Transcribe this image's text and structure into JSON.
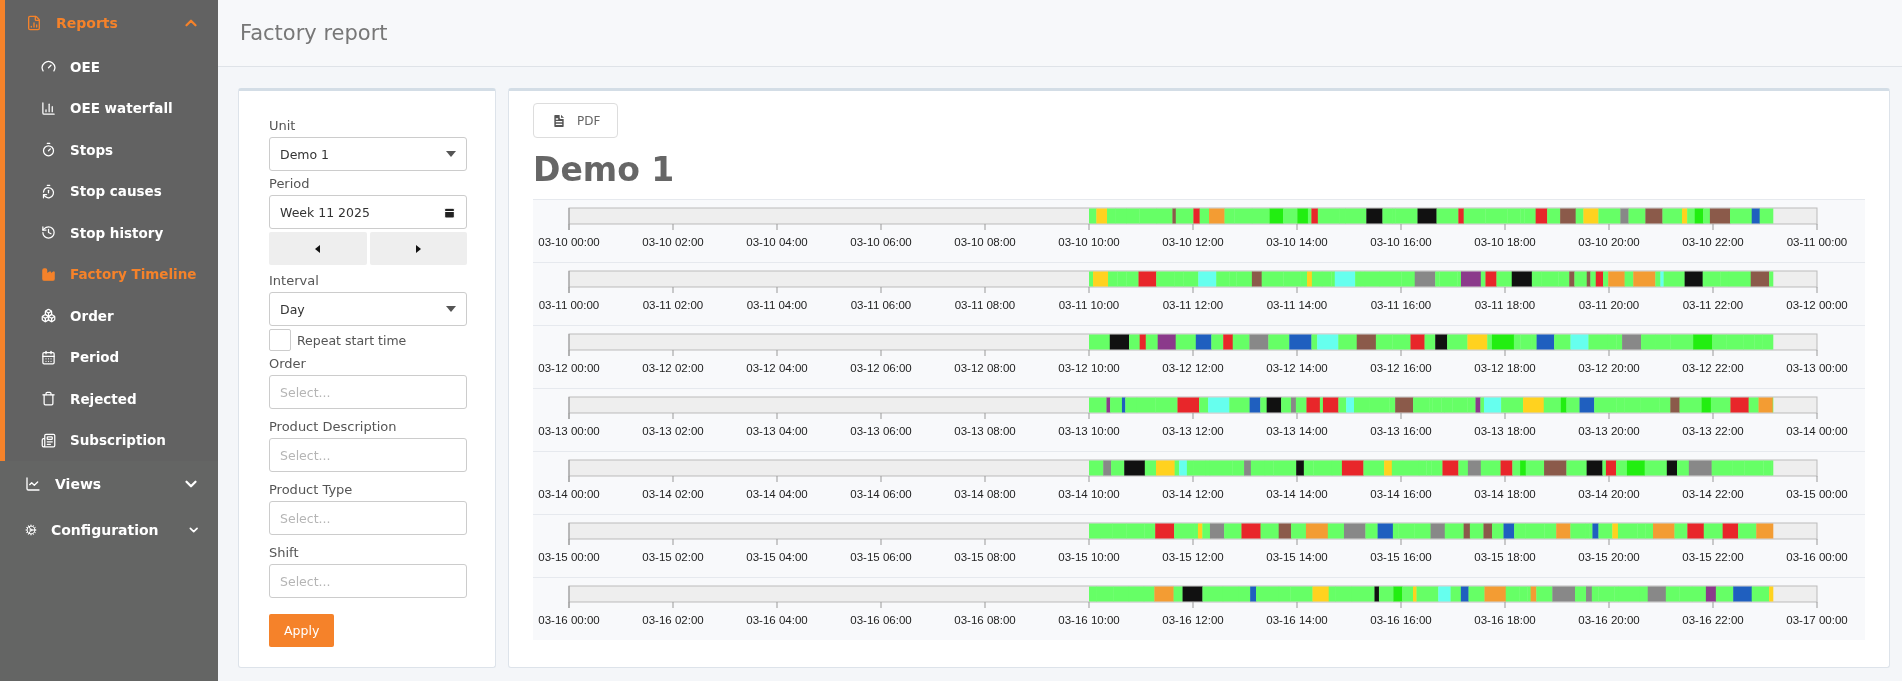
{
  "sidebar": {
    "items": [
      {
        "label": "Reports",
        "expanded": true,
        "children": [
          {
            "label": "OEE",
            "selected": false
          },
          {
            "label": "OEE waterfall",
            "selected": false
          },
          {
            "label": "Stops",
            "selected": false
          },
          {
            "label": "Stop causes",
            "selected": false
          },
          {
            "label": "Stop history",
            "selected": false
          },
          {
            "label": "Factory Timeline",
            "selected": true
          },
          {
            "label": "Order",
            "selected": false
          },
          {
            "label": "Period",
            "selected": false
          },
          {
            "label": "Rejected",
            "selected": false
          },
          {
            "label": "Subscription",
            "selected": false
          }
        ]
      },
      {
        "label": "Views",
        "expanded": false
      },
      {
        "label": "Configuration",
        "expanded": false
      }
    ]
  },
  "header": {
    "title": "Factory report"
  },
  "form": {
    "unit": {
      "label": "Unit",
      "value": "Demo 1"
    },
    "period": {
      "label": "Period",
      "value": "Week 11 2025"
    },
    "interval": {
      "label": "Interval",
      "value": "Day"
    },
    "repeat_start_time": {
      "label": "Repeat start time",
      "checked": false
    },
    "filters": [
      {
        "label": "Order",
        "placeholder": "Select..."
      },
      {
        "label": "Product Description",
        "placeholder": "Select..."
      },
      {
        "label": "Product Type",
        "placeholder": "Select..."
      },
      {
        "label": "Shift",
        "placeholder": "Select..."
      }
    ],
    "apply": "Apply"
  },
  "report": {
    "pdf_button": "PDF",
    "title": "Demo 1",
    "timelines": [
      {
        "ticks": [
          "03-10 00:00",
          "03-10 02:00",
          "03-10 04:00",
          "03-10 06:00",
          "03-10 08:00",
          "03-10 10:00",
          "03-10 12:00",
          "03-10 14:00",
          "03-10 16:00",
          "03-10 18:00",
          "03-10 20:00",
          "03-10 22:00",
          "03-11 00:00"
        ]
      },
      {
        "ticks": [
          "03-11 00:00",
          "03-11 02:00",
          "03-11 04:00",
          "03-11 06:00",
          "03-11 08:00",
          "03-11 10:00",
          "03-11 12:00",
          "03-11 14:00",
          "03-11 16:00",
          "03-11 18:00",
          "03-11 20:00",
          "03-11 22:00",
          "03-12 00:00"
        ]
      },
      {
        "ticks": [
          "03-12 00:00",
          "03-12 02:00",
          "03-12 04:00",
          "03-12 06:00",
          "03-12 08:00",
          "03-12 10:00",
          "03-12 12:00",
          "03-12 14:00",
          "03-12 16:00",
          "03-12 18:00",
          "03-12 20:00",
          "03-12 22:00",
          "03-13 00:00"
        ]
      },
      {
        "ticks": [
          "03-13 00:00",
          "03-13 02:00",
          "03-13 04:00",
          "03-13 06:00",
          "03-13 08:00",
          "03-13 10:00",
          "03-13 12:00",
          "03-13 14:00",
          "03-13 16:00",
          "03-13 18:00",
          "03-13 20:00",
          "03-13 22:00",
          "03-14 00:00"
        ]
      },
      {
        "ticks": [
          "03-14 00:00",
          "03-14 02:00",
          "03-14 04:00",
          "03-14 06:00",
          "03-14 08:00",
          "03-14 10:00",
          "03-14 12:00",
          "03-14 14:00",
          "03-14 16:00",
          "03-14 18:00",
          "03-14 20:00",
          "03-14 22:00",
          "03-15 00:00"
        ]
      },
      {
        "ticks": [
          "03-15 00:00",
          "03-15 02:00",
          "03-15 04:00",
          "03-15 06:00",
          "03-15 08:00",
          "03-15 10:00",
          "03-15 12:00",
          "03-15 14:00",
          "03-15 16:00",
          "03-15 18:00",
          "03-15 20:00",
          "03-15 22:00",
          "03-16 00:00"
        ]
      },
      {
        "ticks": [
          "03-16 00:00",
          "03-16 02:00",
          "03-16 04:00",
          "03-16 06:00",
          "03-16 08:00",
          "03-16 10:00",
          "03-16 12:00",
          "03-16 14:00",
          "03-16 16:00",
          "03-16 18:00",
          "03-16 20:00",
          "03-16 22:00",
          "03-17 00:00"
        ]
      }
    ]
  }
}
